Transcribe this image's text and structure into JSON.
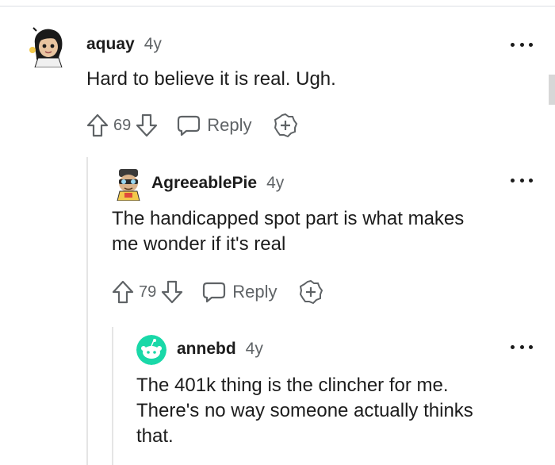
{
  "comments": [
    {
      "username": "aquay",
      "age": "4y",
      "text": "Hard to believe it is real. Ugh.",
      "score": "69",
      "reply_label": "Reply"
    },
    {
      "username": "AgreeablePie",
      "age": "4y",
      "text": "The handicapped spot part is what makes\nme wonder if it's real",
      "score": "79",
      "reply_label": "Reply"
    },
    {
      "username": "annebd",
      "age": "4y",
      "text": "The 401k thing is the clincher for me.\nThere's no way someone actually thinks\nthat."
    }
  ],
  "colors": {
    "text": "#1c1c1c",
    "meta": "#5f6366",
    "thread_line": "#e5e5e5",
    "annebd_avatar": "#19d8a8"
  }
}
